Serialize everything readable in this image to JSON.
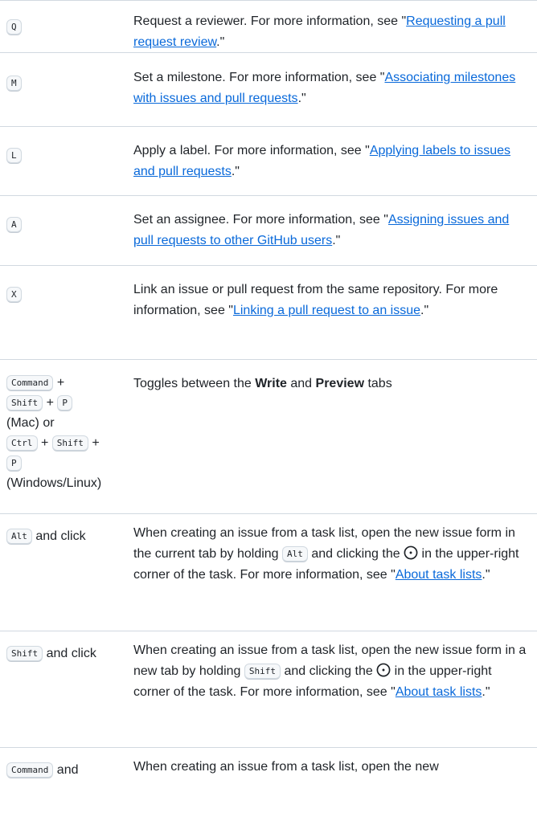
{
  "rows": [
    {
      "key": "Q",
      "desc_pre": "Request a reviewer. For more information, see \"",
      "link": "Requesting a pull request review",
      "desc_post": ".\""
    },
    {
      "key": "M",
      "desc_pre": "Set a milestone. For more information, see \"",
      "link": "Associating milestones with issues and pull requests",
      "desc_post": ".\""
    },
    {
      "key": "L",
      "desc_pre": "Apply a label. For more information, see \"",
      "link": "Applying labels to issues and pull requests",
      "desc_post": ".\""
    },
    {
      "key": "A",
      "desc_pre": "Set an assignee. For more information, see \"",
      "link": "Assigning issues and pull requests to other GitHub users",
      "desc_post": ".\""
    },
    {
      "key": "X",
      "desc_pre": "Link an issue or pull request from the same repository. For more information, see \"",
      "link": "Linking a pull request to an issue",
      "desc_post": ".\""
    }
  ],
  "toggle_row": {
    "keys_mac": [
      "Command",
      "Shift",
      "P"
    ],
    "mac_label": "(Mac) or",
    "keys_win": [
      "Ctrl",
      "Shift",
      "P"
    ],
    "win_label": "(Windows/Linux)",
    "plus": "+",
    "desc_pre": "Toggles between the ",
    "write": "Write",
    "and": " and ",
    "preview": "Preview",
    "desc_post": " tabs"
  },
  "alt_row": {
    "key": "Alt",
    "key_suffix": " and click",
    "desc_1": "When creating an issue from a task list, open the new issue form in the current tab by holding ",
    "desc_key": "Alt",
    "desc_2": " and clicking the ",
    "desc_3": " in the upper-right corner of the task. For more information, see \"",
    "link": "About task lists",
    "desc_post": ".\""
  },
  "shift_row": {
    "key": "Shift",
    "key_suffix": " and click",
    "desc_1": "When creating an issue from a task list, open the new issue form in a new tab by holding ",
    "desc_key": "Shift",
    "desc_2": " and clicking the ",
    "desc_3": " in the upper-right corner of the task. For more information, see \"",
    "link": "About task lists",
    "desc_post": ".\""
  },
  "command_row": {
    "key": "Command",
    "key_suffix": " and",
    "desc": "When creating an issue from a task list, open the new"
  }
}
